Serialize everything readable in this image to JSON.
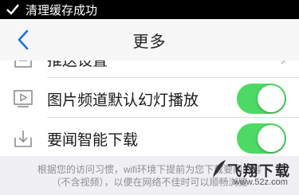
{
  "toast": {
    "text": "清理缓存成功",
    "icon": "checkmark-icon"
  },
  "navbar": {
    "title": "更多",
    "back_icon": "chevron-left-icon"
  },
  "rows": [
    {
      "label": "推送设置",
      "icon": "notification-icon",
      "accessory": "chevron-right-icon"
    },
    {
      "label": "图片频道默认幻灯播放",
      "icon": "slideshow-icon",
      "toggle": true
    },
    {
      "label": "要闻智能下载",
      "icon": "download-icon",
      "toggle": true
    }
  ],
  "note": {
    "line1": "根据您的访问习惯，wifi环境下提前为您下载要闻内容",
    "line2": "（不含视频），以便在网络不佳时可以顺畅浏览"
  },
  "watermark": {
    "text": "飞翔下载",
    "url": "www.52z.com"
  },
  "colors": {
    "toggle_on": "#4cd964",
    "accent": "#1a73e8",
    "background": "#efeff4"
  }
}
